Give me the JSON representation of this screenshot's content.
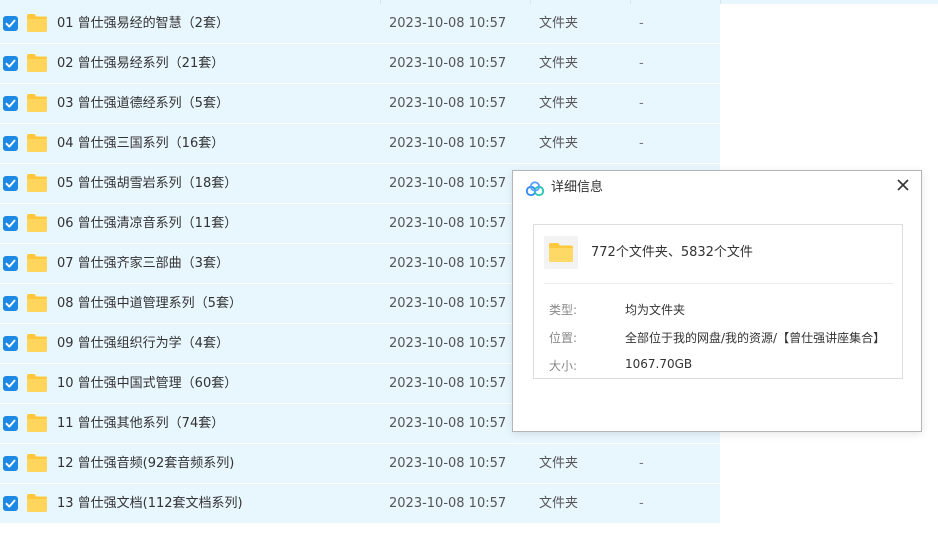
{
  "files": [
    {
      "name": "01 曾仕强易经的智慧（2套）",
      "modified": "2023-10-08 10:57",
      "type": "文件夹",
      "size": "-"
    },
    {
      "name": "02 曾仕强易经系列（21套）",
      "modified": "2023-10-08 10:57",
      "type": "文件夹",
      "size": "-"
    },
    {
      "name": "03 曾仕强道德经系列（5套）",
      "modified": "2023-10-08 10:57",
      "type": "文件夹",
      "size": "-"
    },
    {
      "name": "04 曾仕强三国系列（16套）",
      "modified": "2023-10-08 10:57",
      "type": "文件夹",
      "size": "-"
    },
    {
      "name": "05 曾仕强胡雪岩系列（18套）",
      "modified": "2023-10-08 10:57",
      "type": "",
      "size": ""
    },
    {
      "name": "06 曾仕强清凉音系列（11套）",
      "modified": "2023-10-08 10:57",
      "type": "",
      "size": ""
    },
    {
      "name": "07 曾仕强齐家三部曲（3套）",
      "modified": "2023-10-08 10:57",
      "type": "",
      "size": ""
    },
    {
      "name": "08 曾仕强中道管理系列（5套）",
      "modified": "2023-10-08 10:57",
      "type": "",
      "size": ""
    },
    {
      "name": "09 曾仕强组织行为学（4套）",
      "modified": "2023-10-08 10:57",
      "type": "",
      "size": ""
    },
    {
      "name": "10 曾仕强中国式管理（60套）",
      "modified": "2023-10-08 10:57",
      "type": "",
      "size": ""
    },
    {
      "name": "11 曾仕强其他系列（74套）",
      "modified": "2023-10-08 10:57",
      "type": "",
      "size": ""
    },
    {
      "name": "12 曾仕强音频(92套音频系列)",
      "modified": "2023-10-08 10:57",
      "type": "文件夹",
      "size": "-"
    },
    {
      "name": "13 曾仕强文档(112套文档系列)",
      "modified": "2023-10-08 10:57",
      "type": "文件夹",
      "size": "-"
    }
  ],
  "dialog": {
    "title": "详细信息",
    "summary": "772个文件夹、5832个文件",
    "type_label": "类型:",
    "type_value": "均为文件夹",
    "location_label": "位置:",
    "location_value": "全部位于我的网盘/我的资源/【曾仕强讲座集合】",
    "size_label": "大小:",
    "size_value": "1067.70GB",
    "close_icon": "close-icon",
    "logo_icon": "cloud-logo-icon"
  },
  "colors": {
    "row_selected": "#e8f6fe",
    "checkbox": "#1e88e5",
    "folder": "#ffc83d"
  }
}
